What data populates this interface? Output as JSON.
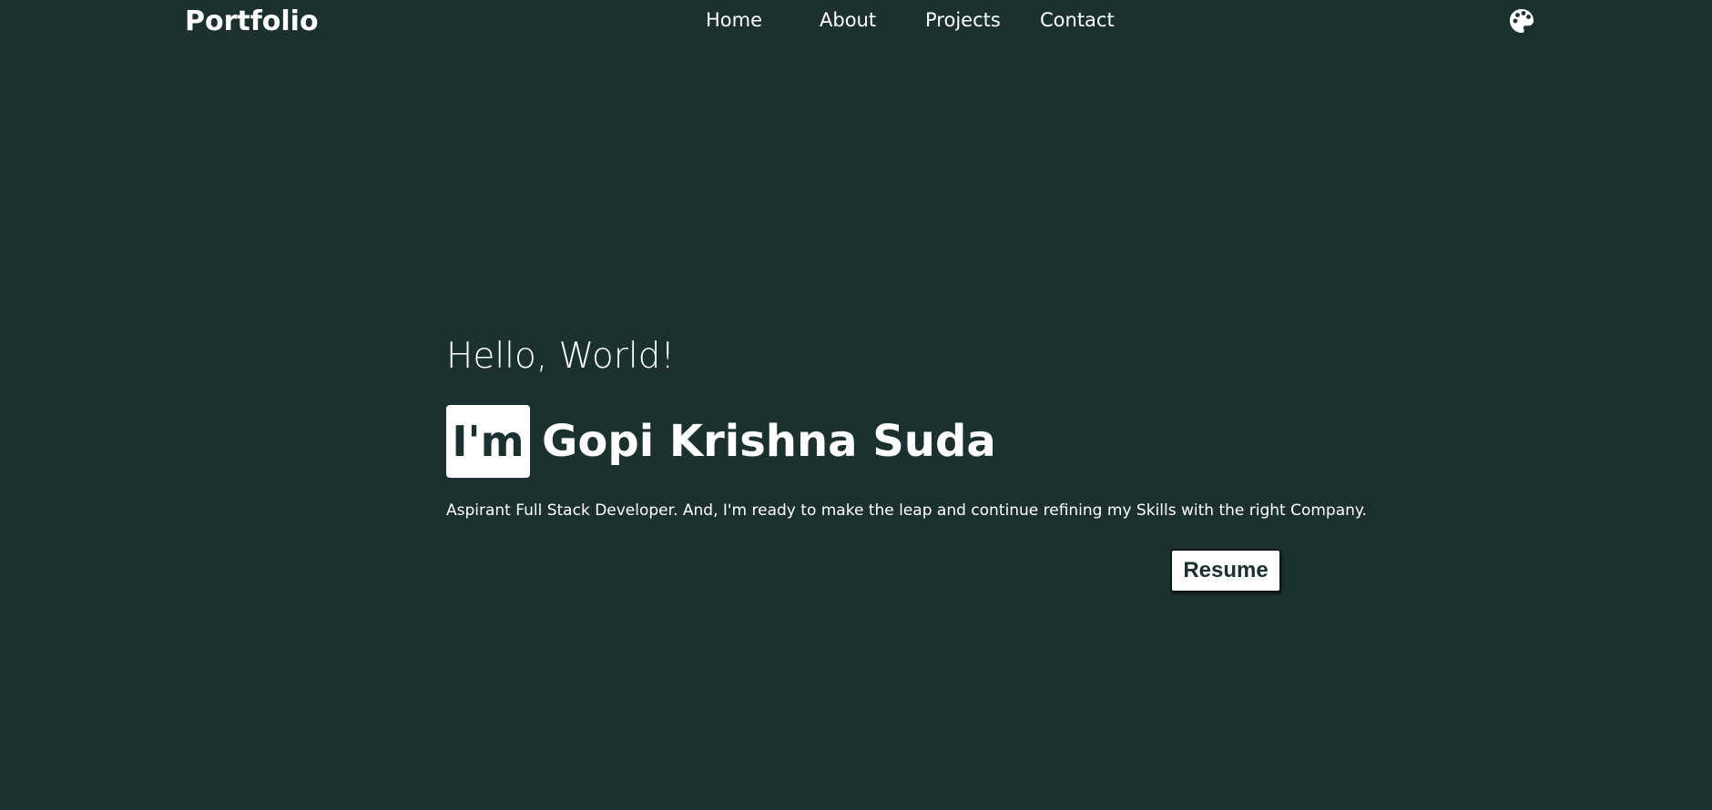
{
  "nav": {
    "brand": "Portfolio",
    "links": [
      "Home",
      "About",
      "Projects",
      "Contact"
    ],
    "theme_icon": "palette-icon"
  },
  "hero": {
    "greeting": "Hello, World!",
    "im_label": "I'm",
    "name": "Gopi Krishna Suda",
    "tagline": "Aspirant Full Stack Developer. And, I'm ready to make the leap and continue refining my Skills with the right Company.",
    "resume_label": "Resume"
  },
  "colors": {
    "background": "#1c302f",
    "text": "#ffffff",
    "accent_box": "#ffffff"
  }
}
